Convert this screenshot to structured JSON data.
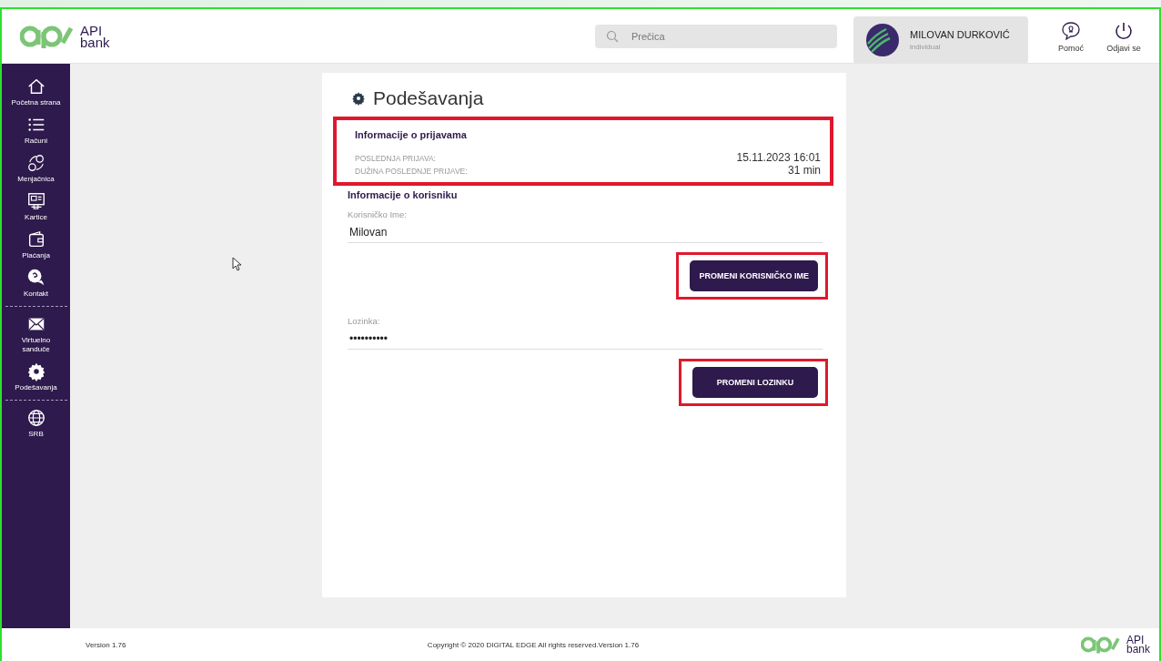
{
  "header": {
    "logo_text": [
      "API",
      "bank"
    ],
    "search": {
      "placeholder": "Prečica"
    },
    "user": {
      "name": "MILOVAN DURKOVIĆ",
      "role": "individual"
    },
    "actions": [
      {
        "kind": "help",
        "label": "Pomoć"
      },
      {
        "kind": "logout",
        "label": "Odjavi se"
      }
    ]
  },
  "sidebar": {
    "groups": [
      [
        {
          "kind": "home",
          "label": "Početna strana"
        },
        {
          "kind": "list",
          "label": "Računi"
        },
        {
          "kind": "exchange",
          "label": "Menjačnica"
        },
        {
          "kind": "cards",
          "label": "Kartice"
        },
        {
          "kind": "wallet",
          "label": "Plaćanja"
        },
        {
          "kind": "contact",
          "label": "Kontakt"
        }
      ],
      [
        {
          "kind": "mail",
          "label": "Virtuelno sanduče"
        },
        {
          "kind": "gear",
          "label": "Podešavanja"
        }
      ],
      [
        {
          "kind": "globe",
          "label": "SRB"
        }
      ]
    ]
  },
  "page": {
    "title": "Podešavanja",
    "login_info": {
      "heading": "Informacije o prijavama",
      "highlighted": true,
      "rows": [
        {
          "label": "POSLEDNJA PRIJAVA:",
          "value": "15.11.2023 16:01"
        },
        {
          "label": "DUŽINA POSLEDNJE PRIJAVE:",
          "value": "31 min"
        }
      ]
    },
    "user_info": {
      "heading": "Informacije o korisniku",
      "fields": [
        {
          "label": "Korisničko Ime:",
          "value": "Milovan",
          "button": "PROMENI KORISNIČKO IME",
          "highlighted": true
        },
        {
          "label": "Lozinka:",
          "value": "••••••••••",
          "button": "PROMENI LOZINKU",
          "highlighted": true
        }
      ]
    }
  },
  "footer": {
    "version": "Version 1.76",
    "copyright": "Copyright © 2020 DIGITAL EDGE All rights reserved.Version 1.76",
    "logo_text": [
      "API",
      "bank"
    ]
  }
}
